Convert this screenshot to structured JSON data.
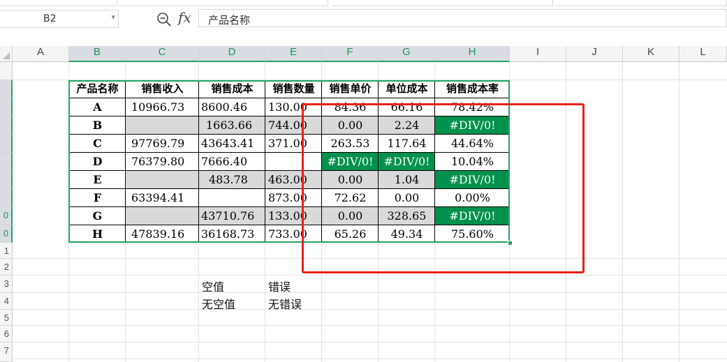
{
  "namebox": {
    "value": "B2"
  },
  "formula": {
    "fx_label": "fx",
    "content": "产品名称"
  },
  "columns": [
    "A",
    "B",
    "C",
    "D",
    "E",
    "F",
    "G",
    "H",
    "I",
    "J",
    "K",
    "L"
  ],
  "rows": [
    "",
    "",
    "",
    "",
    "",
    "",
    "",
    "",
    "0",
    "1",
    "2",
    "3",
    "4",
    "5",
    "6",
    "7"
  ],
  "table": {
    "headers": [
      "产品名称",
      "销售收入",
      "销售成本",
      "销售数量",
      "销售单价",
      "单位成本",
      "销售成本率"
    ],
    "rows": [
      [
        "A",
        "10966.73",
        "8600.46",
        "130.00",
        "84.36",
        "66.16",
        "78.42%"
      ],
      [
        "B",
        "",
        "1663.66",
        "744.00",
        "0.00",
        "2.24",
        "#DIV/0!"
      ],
      [
        "C",
        "97769.79",
        "43643.41",
        "371.00",
        "263.53",
        "117.64",
        "44.64%"
      ],
      [
        "D",
        "76379.80",
        "7666.40",
        "",
        "#DIV/0!",
        "#DIV/0!",
        "10.04%"
      ],
      [
        "E",
        "",
        "483.78",
        "463.00",
        "0.00",
        "1.04",
        "#DIV/0!"
      ],
      [
        "F",
        "63394.41",
        "",
        "873.00",
        "72.62",
        "0.00",
        "0.00%"
      ],
      [
        "G",
        "",
        "43710.76",
        "133.00",
        "0.00",
        "328.65",
        "#DIV/0!"
      ],
      [
        "H",
        "47839.16",
        "36168.73",
        "733.00",
        "65.26",
        "49.34",
        "75.60%"
      ]
    ]
  },
  "legend": [
    [
      "空值",
      "错误"
    ],
    [
      "无空值",
      "无错误"
    ]
  ],
  "colors": {
    "selection": "#21a366",
    "error_fill": "#00914c",
    "blank_fill": "#d9d9d9",
    "annotation": "#e8201a"
  }
}
